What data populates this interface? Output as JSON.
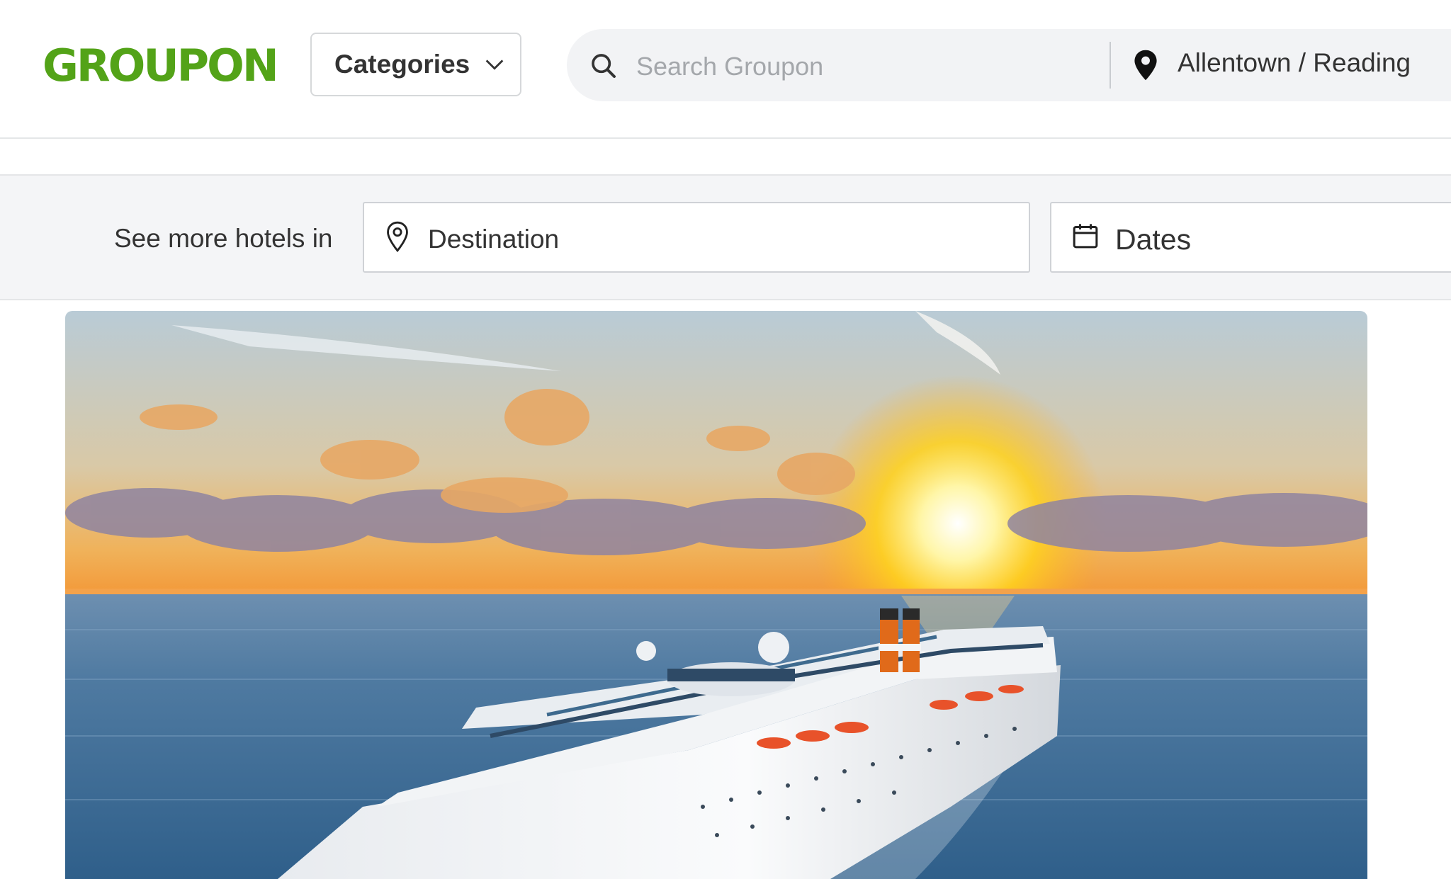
{
  "header": {
    "logo_text": "GROUPON",
    "brand_color": "#53a318",
    "categories_label": "Categories",
    "categories_icon": "chevron-down-icon",
    "search": {
      "placeholder": "Search Groupon",
      "value": "",
      "icon": "search-icon"
    },
    "location": {
      "icon": "map-pin-icon",
      "label": "Allentown / Reading"
    }
  },
  "hotel_search": {
    "label": "See more hotels in",
    "destination": {
      "icon": "location-outline-icon",
      "placeholder": "Destination"
    },
    "dates": {
      "icon": "calendar-icon",
      "placeholder": "Dates"
    }
  },
  "hero": {
    "image_subject": "cruise-ship-at-sunset",
    "colors": {
      "sky": "#9fb6c8",
      "sun": "#ffd21c",
      "sea": "#3d6a93",
      "hull": "#f5f5f7",
      "funnel": "#e06a1a"
    }
  }
}
